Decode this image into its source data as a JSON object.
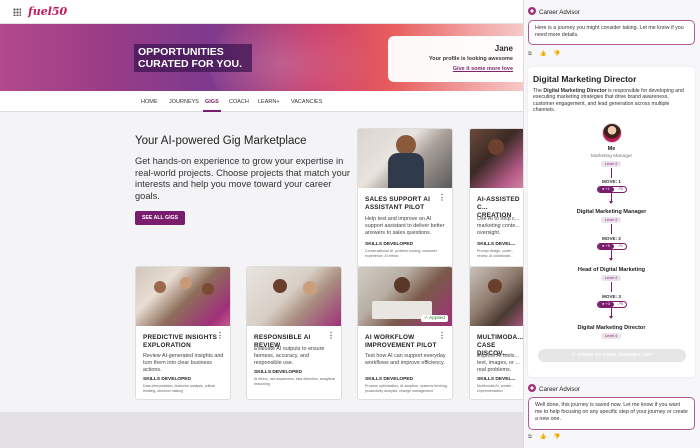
{
  "app": {
    "logo": "fuel50"
  },
  "hero": {
    "title": "OPPORTUNITIES CURATED FOR YOU.",
    "profile_name": "Jane",
    "profile_text": "Your profile is looking awesome",
    "profile_link": "Give it some more love"
  },
  "nav": {
    "items": [
      {
        "label": "HOME"
      },
      {
        "label": "JOURNEYS"
      },
      {
        "label": "GIGS"
      },
      {
        "label": "COACH"
      },
      {
        "label": "LEARN+"
      },
      {
        "label": "VACANCIES"
      }
    ],
    "active": "GIGS"
  },
  "intro": {
    "title": "Your AI-powered Gig Marketplace",
    "body": "Get hands-on experience to grow your expertise in real-world projects. Choose projects that match your interests and help you move toward your career goals.",
    "button": "SEE ALL GIGS"
  },
  "cards": [
    {
      "title": "SALES SUPPORT AI ASSISTANT PILOT",
      "desc": "Help test and improve an AI support assistant to deliver better answers to sales questions.",
      "skills_label": "SKILLS DEVELOPED",
      "skills": "Conversational AI, problem solving, customer experience, AI ethics"
    },
    {
      "title": "AI-ASSISTED C... CREATION",
      "desc": "Use AI to help c... marketing conte... oversight.",
      "skills_label": "SKILLS DEVEL...",
      "skills": "Prompt design, conte... review, AI collaborati..."
    },
    {
      "title": "PREDICTIVE INSIGHTS EXPLORATION",
      "desc": "Review AI-generated insights and turn them into clear business actions.",
      "skills_label": "SKILLS DEVELOPED",
      "skills": "Data interpretation, business analysis, critical thinking, decision making"
    },
    {
      "title": "RESPONSIBLE AI REVIEW",
      "desc": "Evaluate AI outputs to ensure fairness, accuracy, and responsible use.",
      "skills_label": "SKILLS DEVELOPED",
      "skills": "AI ethics, risk awareness, bias detection, analytical reasoning"
    },
    {
      "title": "AI WORKFLOW IMPROVEMENT PILOT",
      "desc": "Test how AI can support everyday workflows and improve efficiency.",
      "skills_label": "SKILLS DEVELOPED",
      "skills": "Process optimization, AI adoption, systems thinking, productivity analysis, change management",
      "badge": "✓ Applied"
    },
    {
      "title": "MULTIMODA... CASE DISCOV...",
      "desc": "Explore AI tools... text, images, or ... real problems.",
      "skills_label": "SKILLS DEVEL...",
      "skills": "Multimodal AI, creativ... experimentation"
    }
  ],
  "panel": {
    "advisor_label": "Career Advisor",
    "message_1": "Here is a journey you might consider taking. Let me know if you need more details.",
    "feedback_icons": "⧉ 👍 👎",
    "journey": {
      "title": "Digital Marketing Director",
      "desc_prefix": "The ",
      "desc_bold": "Digital Marketing Director",
      "desc_rest": " is responsible for developing and executing marketing strategies that drive brand awareness, customer engagement, and lead generation across multiple channels.",
      "me_label": "Me",
      "me_role": "Marketing Manager",
      "me_level": "Level 4",
      "steps": [
        {
          "move": "MOVE: 1",
          "pill_on": "● +1",
          "pill_off": "↗5",
          "name": "Digital Marketing Manager",
          "level": "Level 4"
        },
        {
          "move": "MOVE: 2",
          "pill_on": "● +5",
          "pill_off": "↗1",
          "name": "Head of Digital Marketing",
          "level": "Level 4"
        },
        {
          "move": "MOVE: 3",
          "pill_on": "● +3",
          "pill_off": "↗5",
          "name": "Digital Marketing Director",
          "level": "Level 4"
        }
      ],
      "save_button": "✓ SAVED TO YOUR JOURNEY LIST"
    },
    "message_2": "Well done, this journey is saved now. Let me know if you want me to help focusing on any specific step of your journey or create a new one."
  },
  "colors": {
    "brand": "#7b1d6e",
    "accent": "#c2185b"
  }
}
